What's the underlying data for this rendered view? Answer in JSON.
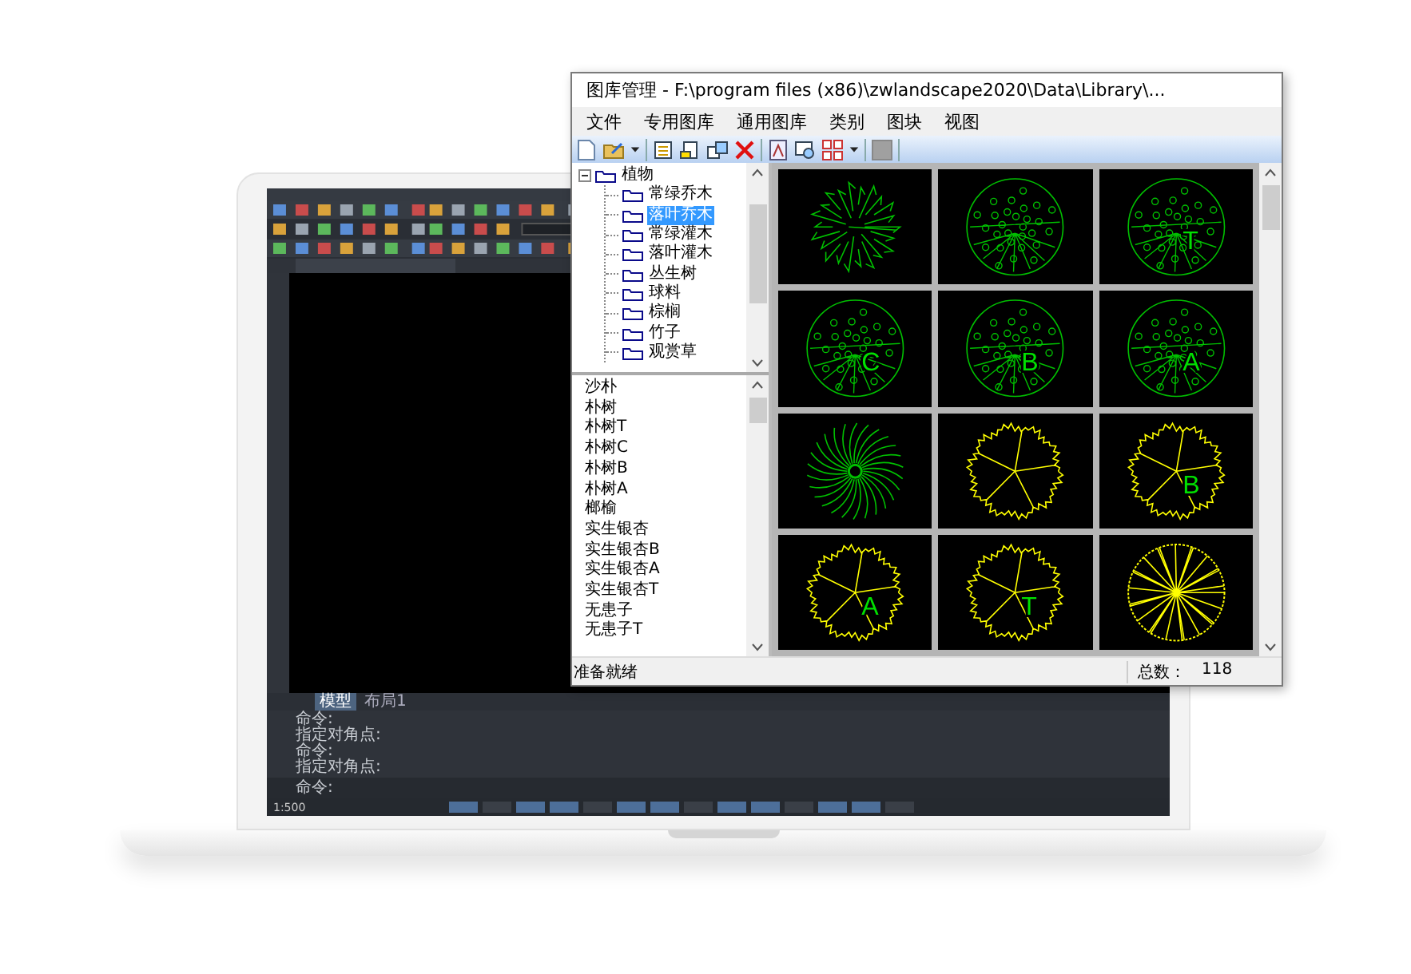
{
  "cad": {
    "commands": [
      "命令:",
      "指定对角点:",
      "命令:",
      "指定对角点:"
    ],
    "prompt": "命令:",
    "scale": "1:500",
    "layout_tabs": [
      {
        "label": "模型",
        "selected": true
      },
      {
        "label": "布局1",
        "selected": false
      }
    ]
  },
  "window": {
    "title": "图库管理 - F:\\program files (x86)\\zwlandscape2020\\Data\\Library\\...",
    "menu": [
      "文件",
      "专用图库",
      "通用图库",
      "类别",
      "图块",
      "视图"
    ],
    "tree": {
      "label": "植物",
      "expanded": true,
      "children": [
        {
          "label": "常绿乔木",
          "selected": false
        },
        {
          "label": "落叶乔木",
          "selected": true
        },
        {
          "label": "常绿灌木",
          "selected": false
        },
        {
          "label": "落叶灌木",
          "selected": false
        },
        {
          "label": "丛生树",
          "selected": false
        },
        {
          "label": "球料",
          "selected": false
        },
        {
          "label": "棕榈",
          "selected": false
        },
        {
          "label": "竹子",
          "selected": false
        },
        {
          "label": "观赏草",
          "selected": false
        }
      ]
    },
    "blocks": [
      "沙朴",
      "朴树",
      "朴树T",
      "朴树C",
      "朴树B",
      "朴树A",
      "榔榆",
      "实生银杏",
      "实生银杏B",
      "实生银杏A",
      "实生银杏T",
      "无患子",
      "无患子T"
    ],
    "thumbnails": [
      {
        "kind": "radial",
        "color": "#00c000"
      },
      {
        "kind": "leafy",
        "color": "#00c000"
      },
      {
        "kind": "leafy",
        "color": "#00c000",
        "label": "T"
      },
      {
        "kind": "leafy",
        "color": "#00c000",
        "label": "C"
      },
      {
        "kind": "leafy",
        "color": "#00c000",
        "label": "B"
      },
      {
        "kind": "leafy",
        "color": "#00c000",
        "label": "A"
      },
      {
        "kind": "star",
        "color": "#00c000"
      },
      {
        "kind": "zigzag",
        "color": "#ffff00"
      },
      {
        "kind": "zigzag",
        "color": "#ffff00",
        "label": "B"
      },
      {
        "kind": "zigzag",
        "color": "#ffff00",
        "label": "A"
      },
      {
        "kind": "zigzag",
        "color": "#ffff00",
        "label": "T"
      },
      {
        "kind": "dense",
        "color": "#ffff00"
      }
    ],
    "status": "准备就绪",
    "count_label": "总数：",
    "count": "118"
  }
}
